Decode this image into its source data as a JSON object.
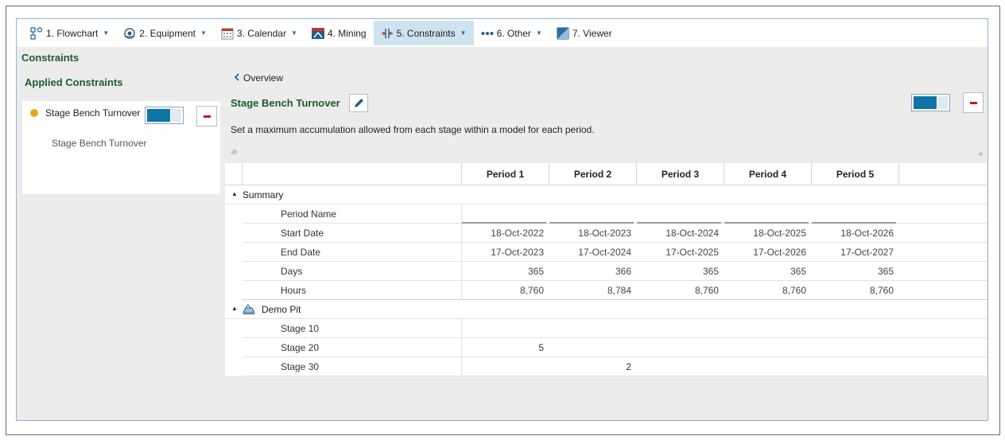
{
  "toolbar": {
    "items": [
      {
        "label": "1. Flowchart",
        "caret": true
      },
      {
        "label": "2. Equipment",
        "caret": true
      },
      {
        "label": "3. Calendar",
        "caret": true
      },
      {
        "label": "4. Mining",
        "caret": false
      },
      {
        "label": "5. Constraints",
        "caret": true,
        "active": true
      },
      {
        "label": "6. Other",
        "caret": true
      },
      {
        "label": "7. Viewer",
        "caret": false
      }
    ]
  },
  "left": {
    "section_title": "Constraints",
    "applied_title": "Applied Constraints",
    "constraint_name": "Stage Bench Turnover",
    "constraint_sub": "Stage Bench Turnover",
    "status_color": "#e6a817"
  },
  "detail": {
    "back_label": "Overview",
    "title": "Stage Bench Turnover",
    "description": "Set a maximum accumulation allowed from each stage within a model for each period."
  },
  "grid": {
    "columns": [
      "Period 1",
      "Period 2",
      "Period 3",
      "Period 4",
      "Period 5"
    ],
    "summary_label": "Summary",
    "summary_rows": [
      {
        "label": "Period Name",
        "values": [
          "",
          "",
          "",
          "",
          ""
        ]
      },
      {
        "label": "Start Date",
        "values": [
          "18-Oct-2022",
          "18-Oct-2023",
          "18-Oct-2024",
          "18-Oct-2025",
          "18-Oct-2026"
        ]
      },
      {
        "label": "End Date",
        "values": [
          "17-Oct-2023",
          "17-Oct-2024",
          "17-Oct-2025",
          "17-Oct-2026",
          "17-Oct-2027"
        ]
      },
      {
        "label": "Days",
        "values": [
          "365",
          "366",
          "365",
          "365",
          "365"
        ]
      },
      {
        "label": "Hours",
        "values": [
          "8,760",
          "8,784",
          "8,760",
          "8,760",
          "8,760"
        ]
      }
    ],
    "pit_label": "Demo Pit",
    "pit_rows": [
      {
        "label": "Stage 10",
        "values": [
          "",
          "",
          "",
          "",
          ""
        ]
      },
      {
        "label": "Stage 20",
        "values": [
          "5",
          "",
          "",
          "",
          ""
        ]
      },
      {
        "label": "Stage 30",
        "values": [
          "",
          "2",
          "",
          "",
          ""
        ]
      }
    ]
  },
  "colors": {
    "accent": "#0f74a8",
    "heading_green": "#1a5c2e",
    "remove_red": "#c4161c",
    "active_tab_bg": "#cde3ef"
  }
}
